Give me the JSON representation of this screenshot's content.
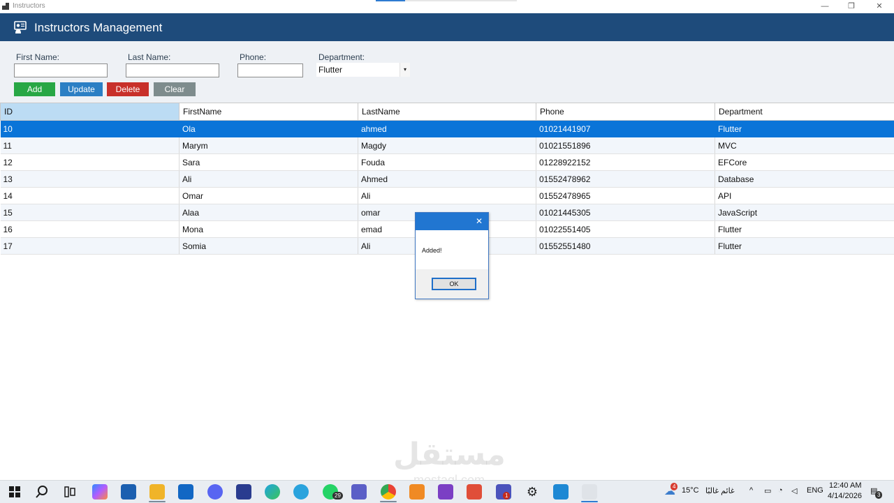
{
  "window": {
    "title": "Instructors",
    "controls": {
      "minimize": "—",
      "maximize": "❐",
      "close": "✕"
    }
  },
  "header": {
    "title": "Instructors Management"
  },
  "form": {
    "first_name_label": "First Name:",
    "last_name_label": "Last Name:",
    "phone_label": "Phone:",
    "department_label": "Department:",
    "first_name_value": "",
    "last_name_value": "",
    "phone_value": "",
    "department_value": "Flutter"
  },
  "buttons": {
    "add": "Add",
    "update": "Update",
    "delete": "Delete",
    "clear": "Clear"
  },
  "colors": {
    "header": "#1e4b7b",
    "add": "#28a745",
    "update": "#2b7fc4",
    "delete": "#c8302a",
    "clear": "#7e8c8d",
    "selection": "#0a74d8"
  },
  "grid": {
    "columns": [
      "ID",
      "FirstName",
      "LastName",
      "Phone",
      "Department"
    ],
    "rows": [
      [
        "10",
        "Ola",
        "ahmed",
        "01021441907",
        "Flutter"
      ],
      [
        "11",
        "Marym",
        "Magdy",
        "01021551896",
        "MVC"
      ],
      [
        "12",
        "Sara",
        "Fouda",
        "01228922152",
        "EFCore"
      ],
      [
        "13",
        "Ali",
        "Ahmed",
        "01552478962",
        "Database"
      ],
      [
        "14",
        "Omar",
        "Ali",
        "01552478965",
        "API"
      ],
      [
        "15",
        "Alaa",
        "omar",
        "01021445305",
        "JavaScript"
      ],
      [
        "16",
        "Mona",
        "emad",
        "01022551405",
        "Flutter"
      ],
      [
        "17",
        "Somia",
        "Ali",
        "01552551480",
        "Flutter"
      ]
    ],
    "selected_row": 0
  },
  "dialog": {
    "message": "Added!",
    "ok_label": "OK",
    "close": "✕"
  },
  "watermark": {
    "text": "مستقل",
    "sub": "mostaql.com"
  },
  "taskbar": {
    "weather_temp": "15°C",
    "weather_text": "غائم غالبًا",
    "weather_badge": "4",
    "language": "ENG",
    "time": "12:40 AM",
    "date": "4/14/2026",
    "notification_count": "3",
    "whatsapp_badge": "29",
    "teams_badge": "1",
    "icons": [
      "windows-start-icon",
      "search-icon",
      "task-view-icon",
      "copilot-icon",
      "store-icon",
      "file-explorer-icon",
      "outlook-icon",
      "discord-icon",
      "vpn-icon",
      "edge-icon",
      "telegram-icon",
      "whatsapp-icon",
      "teams-icon",
      "chrome-icon",
      "postman-icon",
      "visual-studio-icon",
      "git-icon",
      "teams-classic-icon",
      "settings-icon",
      "azure-data-studio-icon",
      "instructors-app-icon"
    ]
  }
}
